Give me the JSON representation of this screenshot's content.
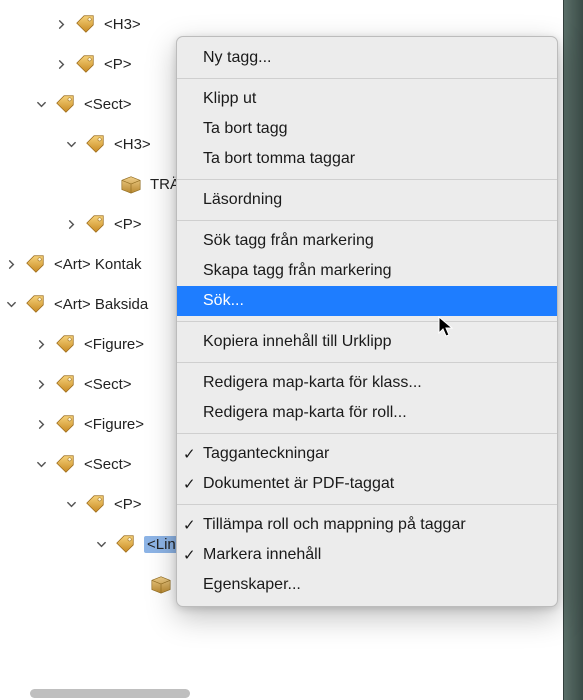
{
  "tree": [
    {
      "indent": 54,
      "disclosure": "right",
      "icon": "tag",
      "label": "<H3>"
    },
    {
      "indent": 54,
      "disclosure": "right",
      "icon": "tag",
      "label": "<P>"
    },
    {
      "indent": 34,
      "disclosure": "down",
      "icon": "tag",
      "label": "<Sect>"
    },
    {
      "indent": 64,
      "disclosure": "down",
      "icon": "tag",
      "label": "<H3>"
    },
    {
      "indent": 100,
      "disclosure": "none",
      "icon": "box",
      "label": "TRÄ"
    },
    {
      "indent": 64,
      "disclosure": "right",
      "icon": "tag",
      "label": "<P>"
    },
    {
      "indent": 4,
      "disclosure": "right",
      "icon": "tag",
      "label": "<Art> Kontak"
    },
    {
      "indent": 4,
      "disclosure": "down",
      "icon": "tag",
      "label": "<Art> Baksida"
    },
    {
      "indent": 34,
      "disclosure": "right",
      "icon": "tag",
      "label": "<Figure>"
    },
    {
      "indent": 34,
      "disclosure": "right",
      "icon": "tag",
      "label": "<Sect>"
    },
    {
      "indent": 34,
      "disclosure": "right",
      "icon": "tag",
      "label": "<Figure>"
    },
    {
      "indent": 34,
      "disclosure": "down",
      "icon": "tag",
      "label": "<Sect>"
    },
    {
      "indent": 64,
      "disclosure": "down",
      "icon": "tag",
      "label": "<P>"
    },
    {
      "indent": 94,
      "disclosure": "down",
      "icon": "tag",
      "label": "<Lin",
      "selected": true
    },
    {
      "indent": 130,
      "disclosure": "none",
      "icon": "box",
      "label": ""
    }
  ],
  "menu": {
    "groups": [
      [
        {
          "label": "Ny tagg...",
          "check": false
        }
      ],
      [
        {
          "label": "Klipp ut",
          "check": false
        },
        {
          "label": "Ta bort tagg",
          "check": false
        },
        {
          "label": "Ta bort tomma taggar",
          "check": false
        }
      ],
      [
        {
          "label": "Läsordning",
          "check": false
        }
      ],
      [
        {
          "label": "Sök tagg från markering",
          "check": false
        },
        {
          "label": "Skapa tagg från markering",
          "check": false
        },
        {
          "label": "Sök...",
          "check": false,
          "highlight": true
        }
      ],
      [
        {
          "label": "Kopiera innehåll till Urklipp",
          "check": false
        }
      ],
      [
        {
          "label": "Redigera map-karta för klass...",
          "check": false
        },
        {
          "label": "Redigera map-karta för roll...",
          "check": false
        }
      ],
      [
        {
          "label": "Tagganteckningar",
          "check": true
        },
        {
          "label": "Dokumentet är PDF-taggat",
          "check": true
        }
      ],
      [
        {
          "label": "Tillämpa roll och mappning på taggar",
          "check": true
        },
        {
          "label": "Markera innehåll",
          "check": true
        },
        {
          "label": "Egenskaper...",
          "check": false
        }
      ]
    ]
  }
}
